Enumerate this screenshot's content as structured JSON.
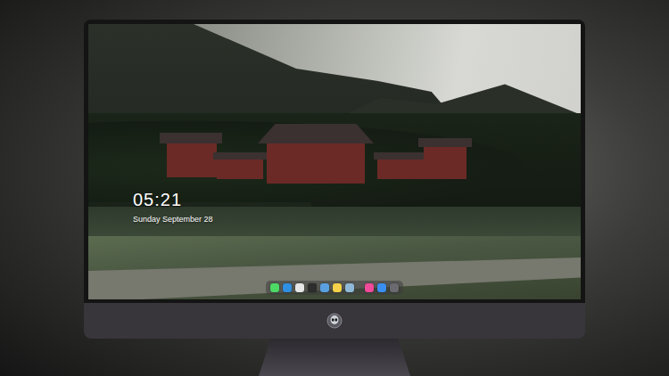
{
  "lock_screen": {
    "time": "05:21",
    "date": "Sunday September 28"
  },
  "dock": [
    {
      "color": "#4cd964"
    },
    {
      "color": "#2f8fe0"
    },
    {
      "color": "#e6e6e6"
    },
    {
      "color": "#2d2d2d"
    },
    {
      "color": "#5aa0e0"
    },
    {
      "color": "#f5d04a"
    },
    {
      "color": "#8fb8d8"
    },
    {
      "color": "#f04a9a"
    },
    {
      "color": "#3a8ef0"
    },
    {
      "color": "#6a6a70"
    }
  ]
}
